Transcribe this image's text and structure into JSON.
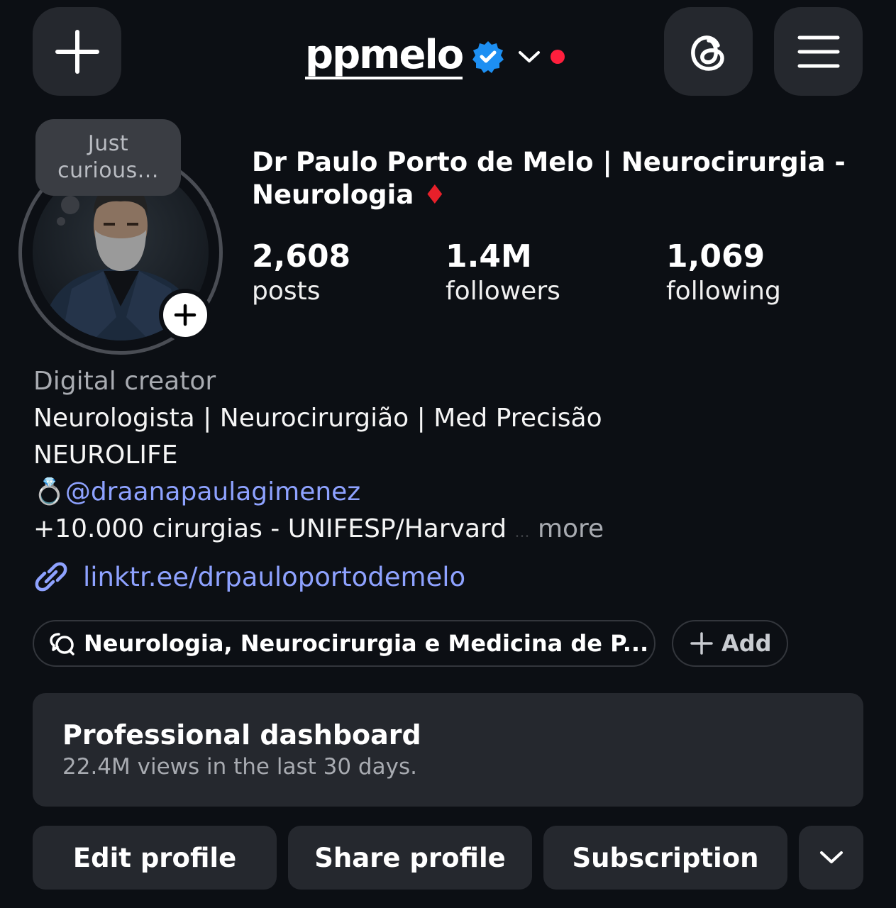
{
  "header": {
    "username": "ppmelo",
    "new_icon": "plus-icon",
    "threads_icon": "threads-icon",
    "menu_icon": "hamburger-menu-icon",
    "accent_verified": "#1d8ff2",
    "notification_dot": "#ff1f3d"
  },
  "note": {
    "text": "Just curious..."
  },
  "profile": {
    "display_name": "Dr Paulo Porto de Melo | Neurocirurgia - Neurologia ♦",
    "stats": [
      {
        "value": "2,608",
        "label": "posts"
      },
      {
        "value": "1.4M",
        "label": "followers"
      },
      {
        "value": "1,069",
        "label": "following"
      }
    ]
  },
  "bio": {
    "category": "Digital creator",
    "line1": "Neurologista | Neurocirurgião | Med Precisão",
    "line2": "NEUROLIFE",
    "ring_emoji": "💍",
    "mention": "@draanapaulagimenez",
    "line4": "+10.000 cirurgias - UNIFESP/Harvard",
    "ellipsis": "...",
    "more": "more",
    "link": "linktr.ee/drpauloportodemelo",
    "link_color": "#8ea2ff"
  },
  "channel": {
    "label": "Neurologia, Neurocirurgia e Medicina de P...",
    "add_label": "Add"
  },
  "dashboard": {
    "title": "Professional dashboard",
    "subtitle": "22.4M views in the last 30 days."
  },
  "actions": {
    "edit": "Edit profile",
    "share": "Share profile",
    "subscription": "Subscription"
  }
}
